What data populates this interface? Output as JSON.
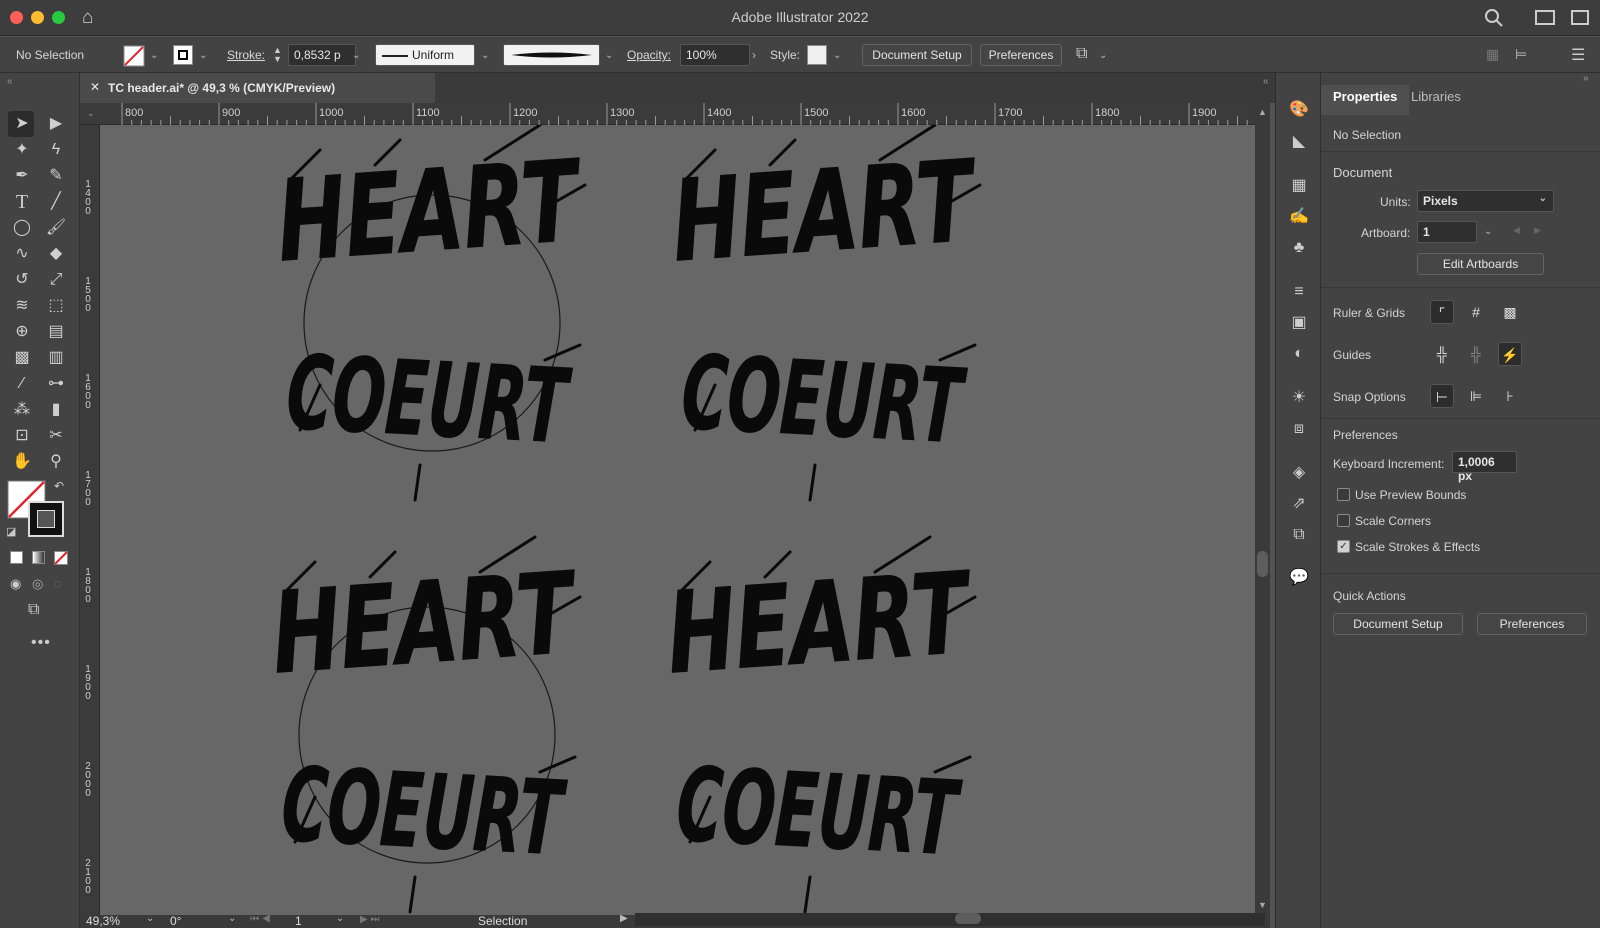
{
  "app": {
    "title": "Adobe Illustrator 2022"
  },
  "control_bar": {
    "selection_label": "No Selection",
    "stroke_label": "Stroke:",
    "stroke_value": "0,8532 p",
    "stroke_profile": "Uniform",
    "opacity_label": "Opacity:",
    "opacity_value": "100%",
    "style_label": "Style:",
    "document_setup": "Document Setup",
    "preferences": "Preferences"
  },
  "document_tab": {
    "label": "TC header.ai* @ 49,3 % (CMYK/Preview)"
  },
  "rulers": {
    "horizontal": [
      "800",
      "900",
      "1000",
      "1100",
      "1200",
      "1300",
      "1400",
      "1500",
      "1600",
      "1700",
      "1800",
      "1900"
    ],
    "vertical": [
      "1400",
      "1500",
      "1600",
      "1700",
      "1800",
      "1900",
      "2000",
      "2100"
    ]
  },
  "artwork": {
    "line1": "HEART",
    "line2": "COEURT"
  },
  "status_bar": {
    "zoom": "49,3%",
    "rotation": "0°",
    "artboard": "1",
    "tool": "Selection"
  },
  "panel": {
    "tabs": [
      "Properties",
      "Libraries"
    ],
    "selection": "No Selection",
    "document_heading": "Document",
    "units_label": "Units:",
    "units_value": "Pixels",
    "artboard_label": "Artboard:",
    "artboard_value": "1",
    "edit_artboards": "Edit Artboards",
    "ruler_grids": "Ruler & Grids",
    "guides": "Guides",
    "snap_options": "Snap Options",
    "preferences_heading": "Preferences",
    "keyboard_increment_label": "Keyboard Increment:",
    "keyboard_increment_value": "1,0006 px",
    "checkboxes": [
      {
        "label": "Use Preview Bounds",
        "checked": false
      },
      {
        "label": "Scale Corners",
        "checked": false
      },
      {
        "label": "Scale Strokes & Effects",
        "checked": true
      }
    ],
    "quick_actions_heading": "Quick Actions",
    "qa_document_setup": "Document Setup",
    "qa_preferences": "Preferences"
  }
}
